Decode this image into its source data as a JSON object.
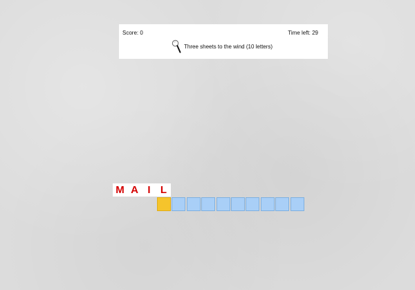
{
  "header": {
    "score_text": "Score: 0",
    "time_left_text": "Time left: 29",
    "clue_text": "Three sheets to the wind (10 letters)",
    "hint_icon": "magnifying-glass-icon"
  },
  "typed_letters": [
    "M",
    "A",
    "I",
    "L"
  ],
  "answer": {
    "length": 10,
    "active_index": 0
  },
  "colors": {
    "typed_letter": "#d40000",
    "answer_box": "#a9cff7",
    "answer_box_active": "#f5c42c",
    "background": "#dcdcdc"
  }
}
